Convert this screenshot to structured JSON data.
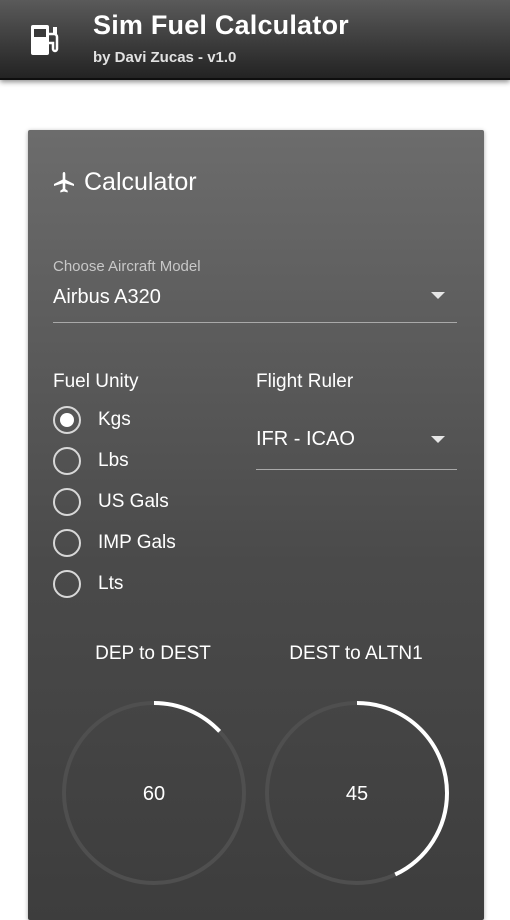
{
  "header": {
    "title": "Sim Fuel Calculator",
    "subtitle": "by Davi Zucas - v1.0",
    "icon": "fuel-pump-icon"
  },
  "calculator": {
    "title": "Calculator",
    "title_icon": "airplane-icon",
    "aircraft": {
      "label": "Choose Aircraft Model",
      "value": "Airbus A320"
    },
    "fuel_unity": {
      "label": "Fuel Unity",
      "options": [
        "Kgs",
        "Lbs",
        "US Gals",
        "IMP Gals",
        "Lts"
      ],
      "selected": "Kgs"
    },
    "flight_ruler": {
      "label": "Flight Ruler",
      "value": "IFR - ICAO"
    },
    "knobs": [
      {
        "title": "DEP to DEST",
        "value": "60",
        "level_fraction": 0.13
      },
      {
        "title": "DEST to ALTN1",
        "value": "45",
        "level_fraction": 0.43
      }
    ]
  },
  "colors": {
    "appbar": "#2e2e2e",
    "card": "#5a5a5a",
    "accent": "#ffffff",
    "track": "#4d4d4d"
  }
}
